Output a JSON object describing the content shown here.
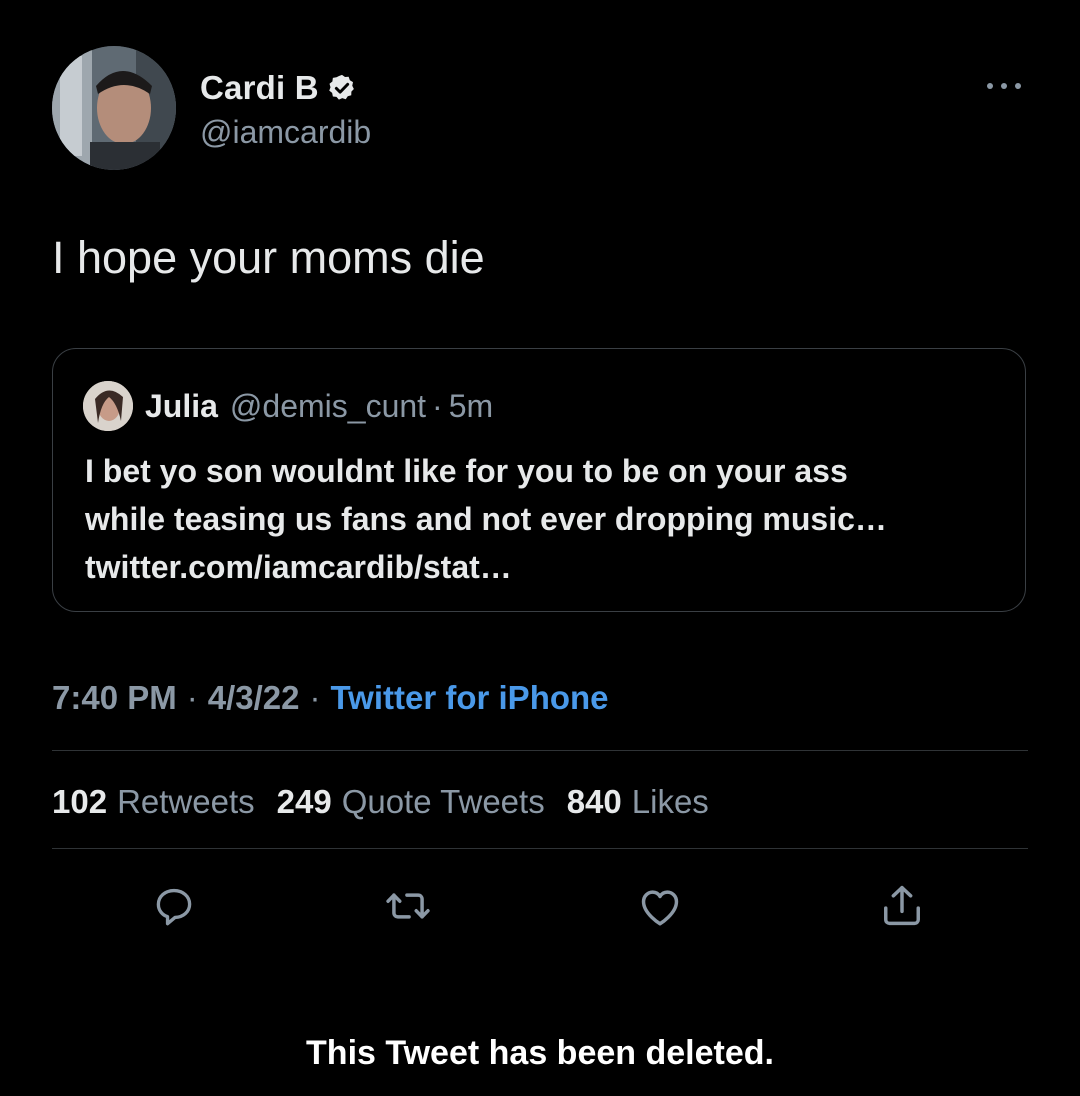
{
  "author": {
    "display_name": "Cardi B",
    "handle": "@iamcardib",
    "verified": true,
    "avatar_icon": "profile-photo"
  },
  "tweet": {
    "text": "I hope your moms die"
  },
  "quoted_tweet": {
    "display_name": "Julia",
    "handle": "@demis_cunt",
    "separator": "·",
    "time": "5m",
    "lines": [
      "I bet yo son wouldnt like for you to be on your ass",
      "while teasing us fans and not ever dropping music…",
      "twitter.com/iamcardib/stat…"
    ]
  },
  "meta": {
    "time": "7:40 PM",
    "separator": "·",
    "date": "4/3/22",
    "source": "Twitter for iPhone"
  },
  "stats": {
    "retweets_count": "102",
    "retweets_label": "Retweets",
    "quotes_count": "249",
    "quotes_label": "Quote Tweets",
    "likes_count": "840",
    "likes_label": "Likes"
  },
  "actions": [
    "reply-icon",
    "retweet-icon",
    "like-icon",
    "share-icon"
  ],
  "notice": "This Tweet has been deleted.",
  "colors": {
    "background": "#000000",
    "text_primary": "#e7e9ea",
    "text_secondary": "#8b98a5",
    "link": "#4a99e9",
    "border": "#2f3336"
  }
}
